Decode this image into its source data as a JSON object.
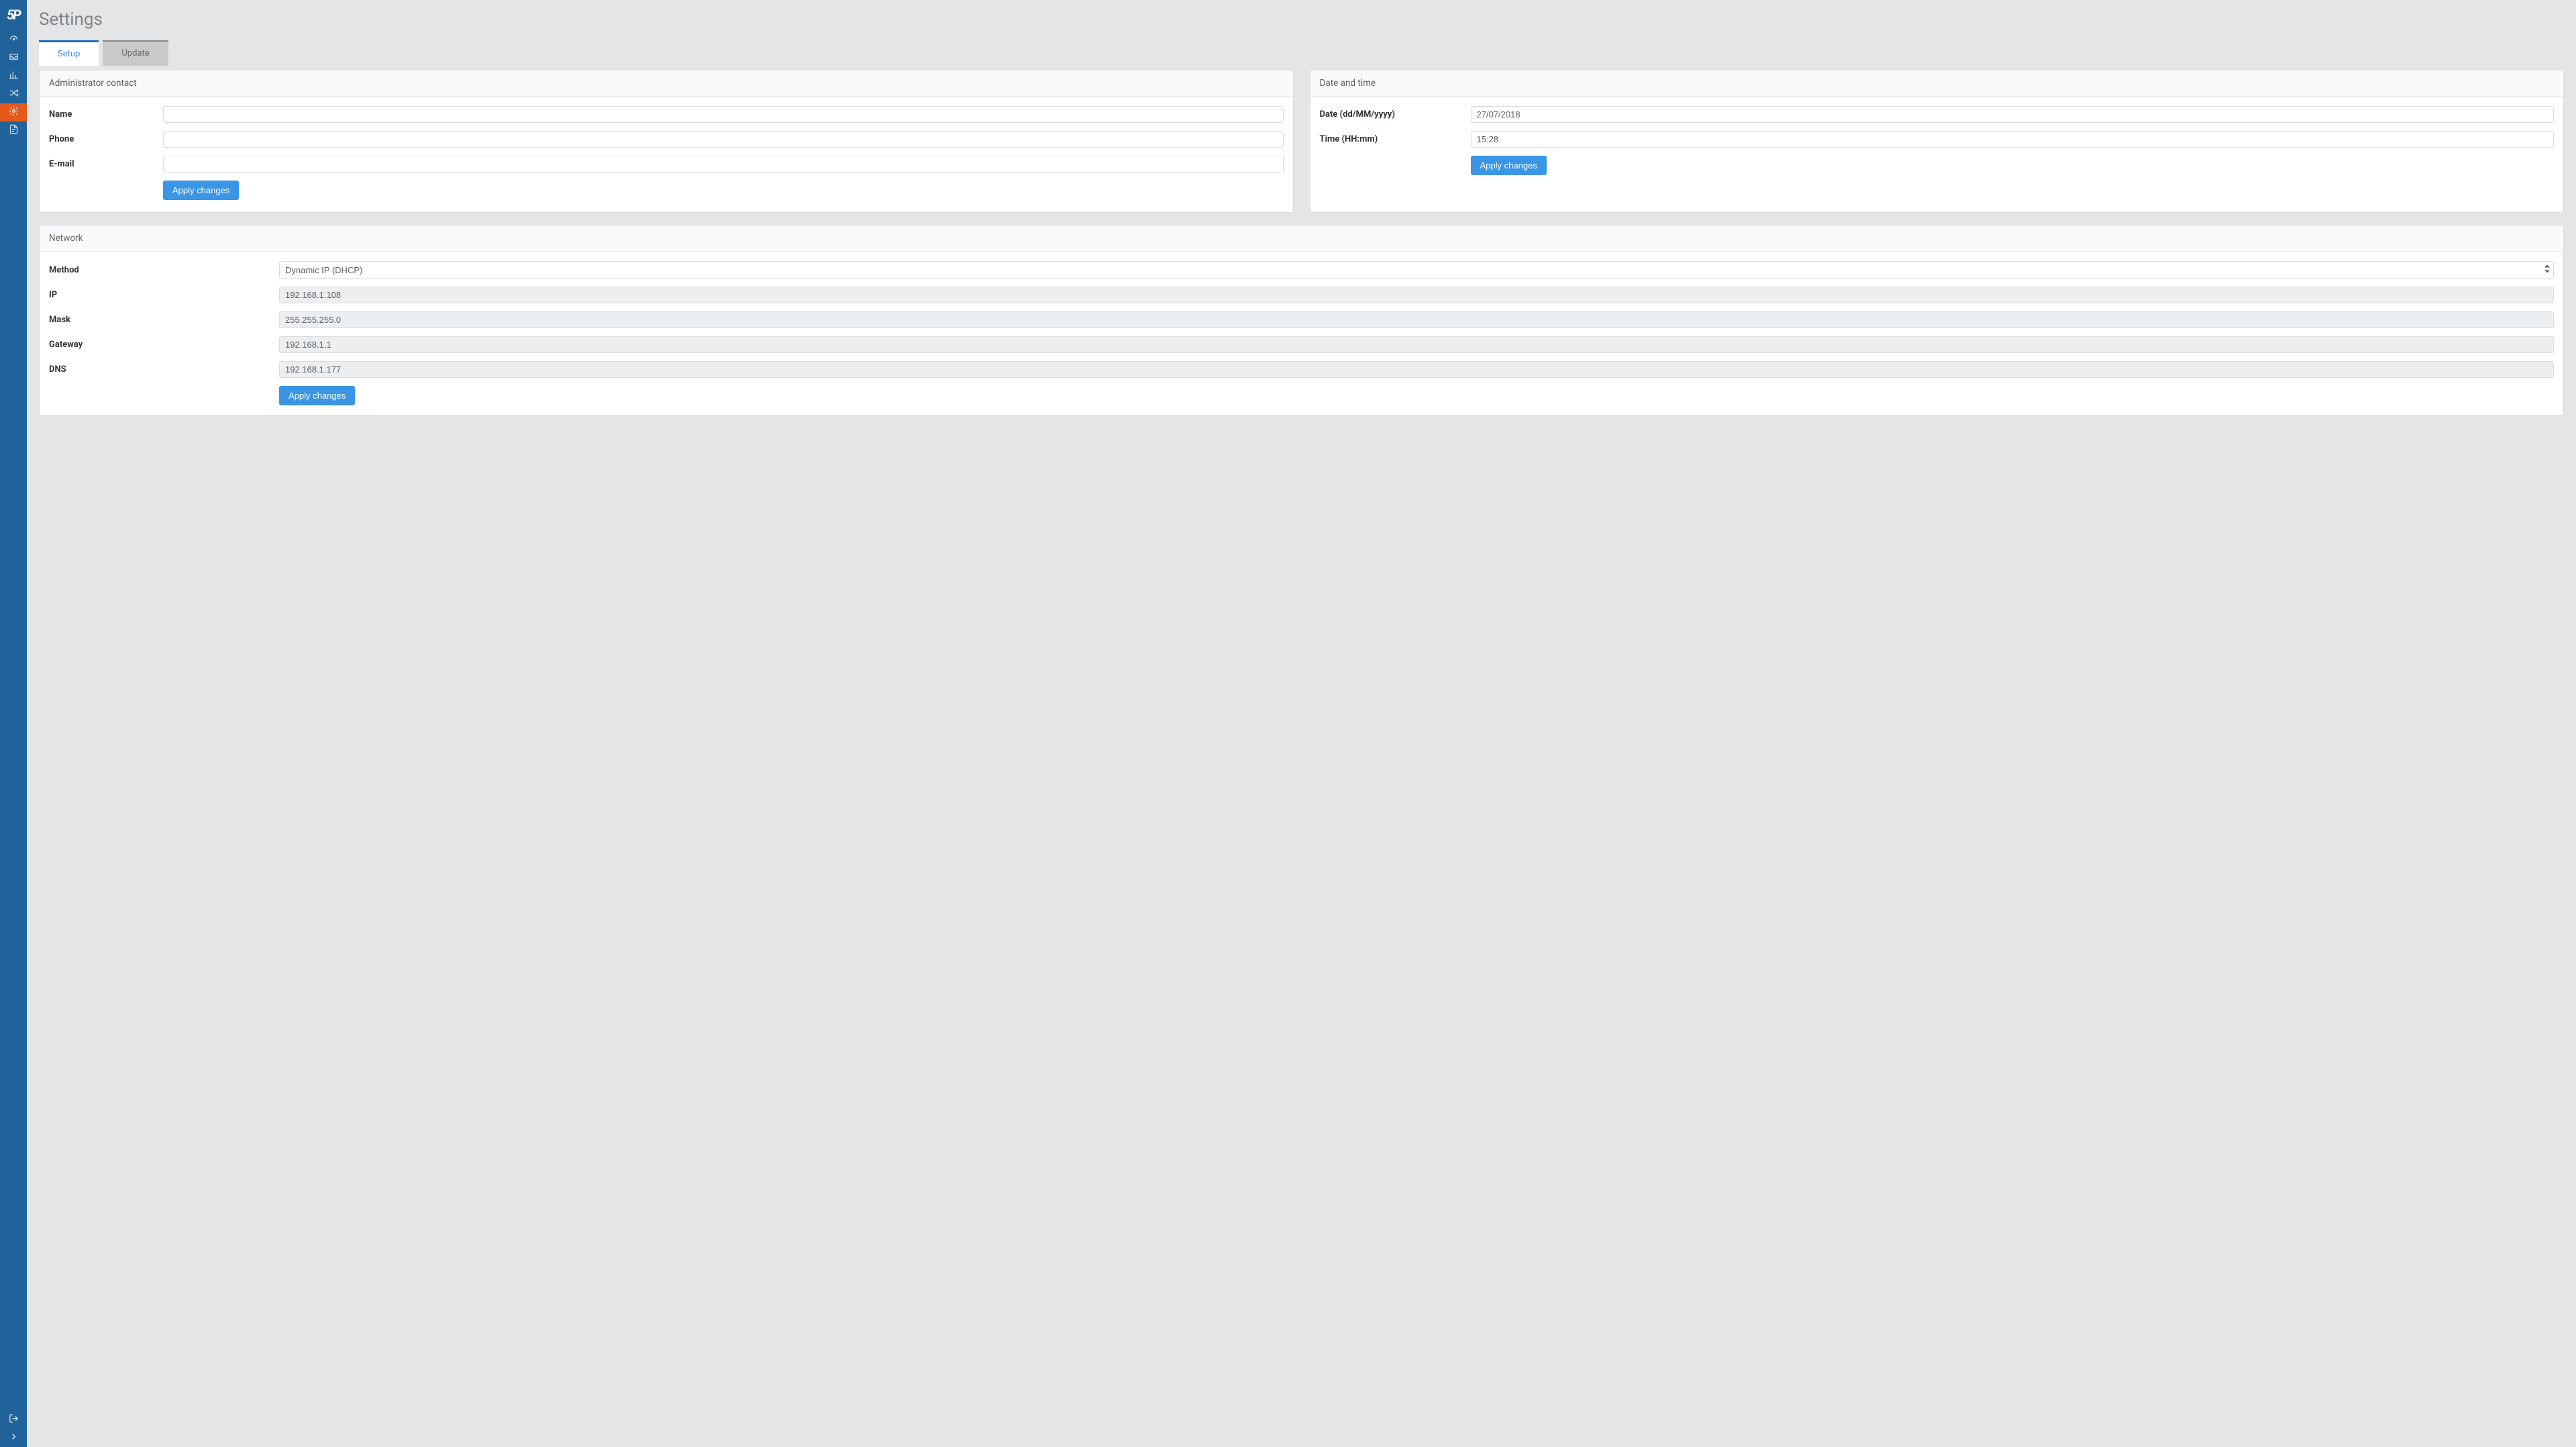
{
  "page": {
    "title": "Settings"
  },
  "tabs": {
    "setup": "Setup",
    "update": "Update"
  },
  "admin_contact": {
    "panel_title": "Administrator contact",
    "name_label": "Name",
    "phone_label": "Phone",
    "email_label": "E-mail",
    "name_value": "",
    "phone_value": "",
    "email_value": "",
    "apply_label": "Apply changes"
  },
  "datetime": {
    "panel_title": "Date and time",
    "date_label": "Date (dd/MM/yyyy)",
    "time_label": "Time (HH:mm)",
    "date_value": "27/07/2018",
    "time_value": "15:28",
    "apply_label": "Apply changes"
  },
  "network": {
    "panel_title": "Network",
    "method_label": "Method",
    "method_value": "Dynamic IP (DHCP)",
    "ip_label": "IP",
    "ip_value": "192.168.1.108",
    "mask_label": "Mask",
    "mask_value": "255.255.255.0",
    "gateway_label": "Gateway",
    "gateway_value": "192.168.1.1",
    "dns_label": "DNS",
    "dns_value": "192.168.1.177",
    "apply_label": "Apply changes"
  }
}
